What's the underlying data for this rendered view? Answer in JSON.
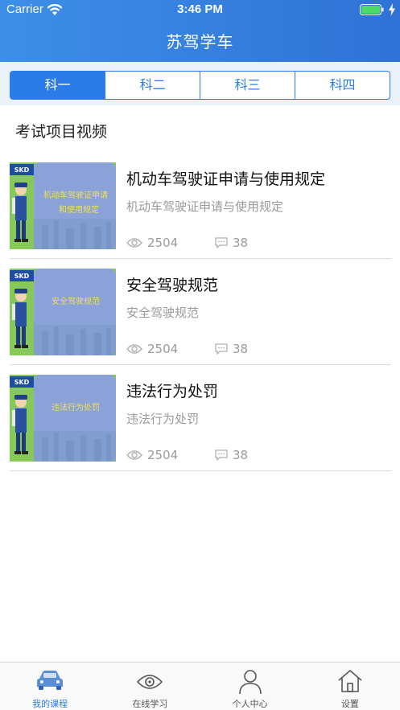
{
  "status_bar": {
    "carrier": "Carrier",
    "time": "3:46 PM"
  },
  "header": {
    "title": "苏驾学车"
  },
  "tabs": [
    {
      "label": "科一",
      "active": true
    },
    {
      "label": "科二",
      "active": false
    },
    {
      "label": "科三",
      "active": false
    },
    {
      "label": "科四",
      "active": false
    }
  ],
  "section": {
    "title": "考试项目视频"
  },
  "videos": [
    {
      "title": "机动车驾驶证申请与使用规定",
      "subtitle": "机动车驾驶证申请与使用规定",
      "views": "2504",
      "comments": "38",
      "thumb_text_line1": "机动车驾驶证申请",
      "thumb_text_line2": "和使用规定",
      "logo": "SKD"
    },
    {
      "title": "安全驾驶规范",
      "subtitle": "安全驾驶规范",
      "views": "2504",
      "comments": "38",
      "thumb_text_line1": "安全驾驶规范",
      "thumb_text_line2": "",
      "logo": "SKD"
    },
    {
      "title": "违法行为处罚",
      "subtitle": "违法行为处罚",
      "views": "2504",
      "comments": "38",
      "thumb_text_line1": "违法行为处罚",
      "thumb_text_line2": "",
      "logo": "SKD"
    }
  ],
  "tabbar": [
    {
      "label": "我的课程",
      "icon": "car-icon",
      "active": true
    },
    {
      "label": "在线学习",
      "icon": "eye-icon",
      "active": false
    },
    {
      "label": "个人中心",
      "icon": "person-icon",
      "active": false
    },
    {
      "label": "设置",
      "icon": "home-icon",
      "active": false
    }
  ],
  "colors": {
    "primary": "#2b7ce9",
    "header_start": "#3d8fe8",
    "muted_text": "#9a9a9a"
  }
}
